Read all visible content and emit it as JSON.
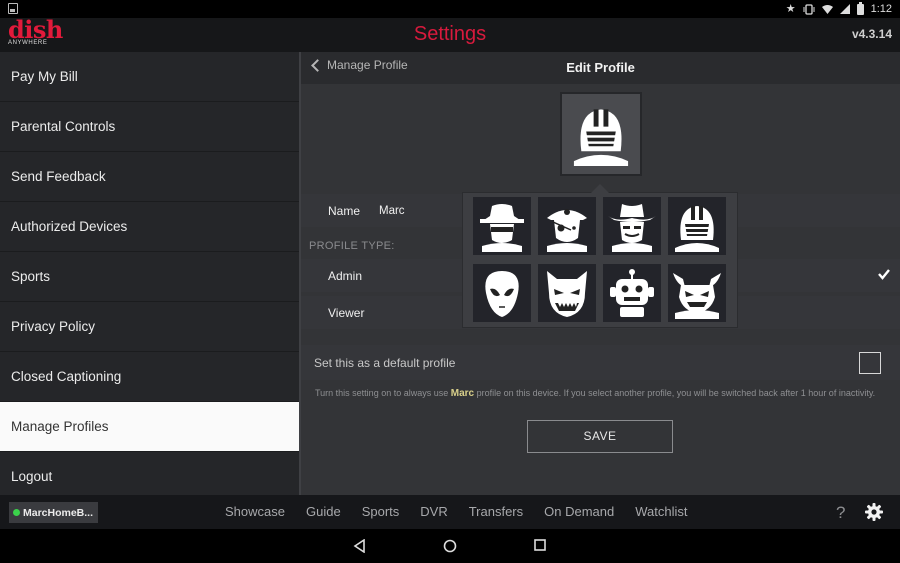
{
  "status_bar": {
    "time": "1:12"
  },
  "header": {
    "logo_word": "dish",
    "logo_sub": "ANYWHERE",
    "title": "Settings",
    "version": "v4.3.14"
  },
  "sidebar": {
    "items": [
      {
        "label": "Pay My Bill"
      },
      {
        "label": "Parental Controls"
      },
      {
        "label": "Send Feedback"
      },
      {
        "label": "Authorized Devices"
      },
      {
        "label": "Sports"
      },
      {
        "label": "Privacy Policy"
      },
      {
        "label": "Closed Captioning"
      },
      {
        "label": "Manage Profiles",
        "active": true
      },
      {
        "label": "Logout"
      }
    ]
  },
  "edit_profile": {
    "back_label": "Manage Profile",
    "title": "Edit Profile",
    "selected_avatar": "football-helmet-icon",
    "name_label": "Name",
    "name_value": "Marc",
    "profile_type_label": "PROFILE TYPE:",
    "types": [
      {
        "label": "Admin",
        "checked": true
      },
      {
        "label": "Viewer",
        "checked": false
      }
    ],
    "default_label": "Set this as a default profile",
    "default_checked": false,
    "help_pre": "Turn this setting on to always use",
    "help_name": "Marc",
    "help_post": "profile on this device. If you select another profile, you will be switched back after 1 hour of inactivity.",
    "save_label": "SAVE"
  },
  "avatar_picker": {
    "avatars": [
      "spy-icon",
      "pirate-icon",
      "cowboy-icon",
      "football-helmet-icon",
      "alien-icon",
      "monster-icon",
      "robot-icon",
      "demon-icon"
    ]
  },
  "bottom_nav": {
    "device": "MarcHomeB...",
    "device_status_color": "#3bd24b",
    "links": [
      "Showcase",
      "Guide",
      "Sports",
      "DVR",
      "Transfers",
      "On Demand",
      "Watchlist"
    ],
    "help": "?"
  },
  "colors": {
    "brand": "#d81a3d",
    "sidebar_active": "#fafafa"
  }
}
